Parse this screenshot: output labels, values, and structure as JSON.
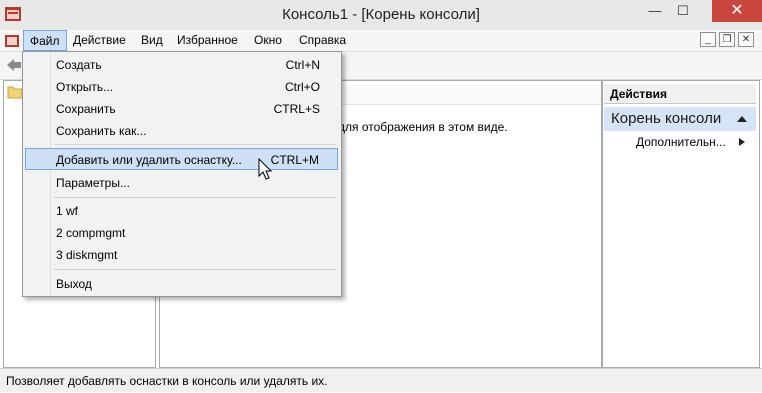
{
  "window": {
    "title": "Консоль1 - [Корень консоли]",
    "minimize_glyph": "—",
    "maximize_glyph": "☐",
    "close_glyph": "✕"
  },
  "menubar": {
    "items": [
      "Файл",
      "Действие",
      "Вид",
      "Избранное",
      "Окно",
      "Справка"
    ]
  },
  "mdi": {
    "minimize": "_",
    "restore": "❐",
    "close": "✕"
  },
  "file_menu": {
    "items": [
      {
        "label": "Создать",
        "shortcut": "Ctrl+N"
      },
      {
        "label": "Открыть...",
        "shortcut": "Ctrl+O"
      },
      {
        "label": "Сохранить",
        "shortcut": "CTRL+S"
      },
      {
        "label": "Сохранить как...",
        "shortcut": ""
      },
      {
        "label": "Добавить или удалить оснастку...",
        "shortcut": "CTRL+M"
      },
      {
        "label": "Параметры...",
        "shortcut": ""
      },
      {
        "label": "1 wf",
        "shortcut": ""
      },
      {
        "label": "2 compmgmt",
        "shortcut": ""
      },
      {
        "label": "3 diskmgmt",
        "shortcut": ""
      },
      {
        "label": "Выход",
        "shortcut": ""
      }
    ],
    "highlighted_index": 4
  },
  "center": {
    "message_fragment": "для отображения в этом виде."
  },
  "actions": {
    "header": "Действия",
    "section": "Корень консоли",
    "sub_item": "Дополнительн..."
  },
  "statusbar": {
    "text": "Позволяет добавлять оснастки в консоль или удалять их."
  },
  "colors": {
    "highlight": "#cde0f5",
    "highlight_border": "#7aa7d9",
    "close_button": "#c9463d",
    "actions_section": "#d6e5f5"
  }
}
